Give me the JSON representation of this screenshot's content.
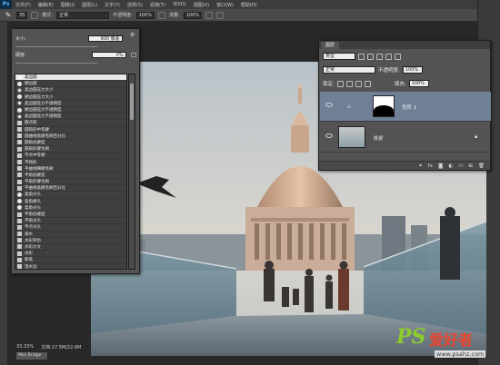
{
  "app": {
    "logo": "Ps"
  },
  "menubar": {
    "items": [
      "文件(F)",
      "编辑(E)",
      "图像(I)",
      "图层(L)",
      "文字(Y)",
      "选择(S)",
      "滤镜(T)",
      "3D(D)",
      "视图(V)",
      "窗口(W)",
      "帮助(H)"
    ]
  },
  "options": {
    "brush_size": "35",
    "mode_label": "模式:",
    "mode_value": "正常",
    "opacity_label": "不透明度:",
    "opacity_value": "100%",
    "flow_label": "流量:",
    "flow_value": "100%"
  },
  "brush_panel": {
    "size_label": "大小:",
    "size_value": "900 像素",
    "hardness_label": "硬度:",
    "hardness_value": "0%",
    "presets": [
      "柔边圆",
      "硬边圆",
      "柔边圆压力大小",
      "硬边圆压力大小",
      "柔边圆压力不透明度",
      "硬边圆压力不透明度",
      "柔边圆压力不透明度",
      "圆点刺",
      "圆钝形中等硬",
      "圆曲线低硬毛刷百分比",
      "圆角低硬度",
      "圆扇形硬毛刷",
      "平点中等硬",
      "平钝形",
      "平曲线细硬毛刷",
      "平角低硬度",
      "平扇形硬毛刷",
      "平曲线低硬毛刷百分比",
      "柔角尖头",
      "柔角硬头",
      "柔角尖头",
      "平角低硬度",
      "平角尖头",
      "平点尖头",
      "滴水",
      "水彩荣仿",
      "水彩沙文",
      "水彩",
      "粉笔",
      "湿水边"
    ]
  },
  "layers_panel": {
    "tab": "图层",
    "kind_filter": "类型",
    "blend_mode": "正常",
    "opacity_label": "不透明度:",
    "opacity_value": "100%",
    "lock_label": "锁定:",
    "fill_label": "填充:",
    "fill_value": "100%",
    "layers": [
      {
        "name": "色阶 1",
        "active": true
      },
      {
        "name": "背景",
        "active": false
      }
    ]
  },
  "status": {
    "zoom": "33.33%",
    "doc": "文档:17.5M/22.6M",
    "tag": "Mini Bridge"
  },
  "watermark": {
    "ps": "PS",
    "cn": "爱好者",
    "url": "www.psahz.com"
  },
  "colors": {
    "selected_layer": "#6f7f96",
    "logo_green": "#8ccd2e",
    "logo_red": "#e7452e"
  }
}
